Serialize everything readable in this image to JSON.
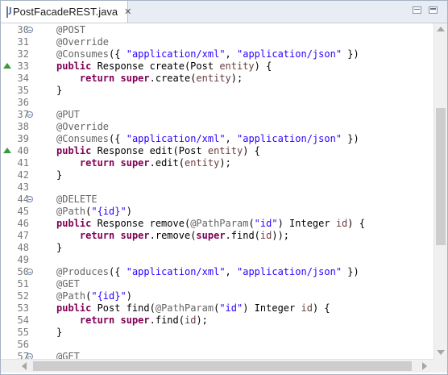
{
  "tab": {
    "title": "PostFacadeREST.java",
    "close_glyph": "✕",
    "icon": "java-file-icon",
    "icon_letter": "J"
  },
  "lines": [
    {
      "num": "30",
      "fold": true,
      "override": false,
      "tokens": [
        [
          "an",
          "@POST"
        ]
      ]
    },
    {
      "num": "31",
      "fold": false,
      "override": false,
      "tokens": [
        [
          "an",
          "@Override"
        ]
      ]
    },
    {
      "num": "32",
      "fold": false,
      "override": false,
      "tokens": [
        [
          "an",
          "@Consumes"
        ],
        [
          "",
          "({ "
        ],
        [
          "str",
          "\"application/xml\""
        ],
        [
          "",
          ", "
        ],
        [
          "str",
          "\"application/json\""
        ],
        [
          "",
          " })"
        ]
      ]
    },
    {
      "num": "33",
      "fold": false,
      "override": true,
      "tokens": [
        [
          "kw",
          "public"
        ],
        [
          "",
          " Response create(Post "
        ],
        [
          "prm",
          "entity"
        ],
        [
          "",
          ") {"
        ]
      ]
    },
    {
      "num": "34",
      "fold": false,
      "override": false,
      "tokens": [
        [
          "",
          "    "
        ],
        [
          "kw",
          "return"
        ],
        [
          "",
          " "
        ],
        [
          "kw",
          "super"
        ],
        [
          "",
          ".create("
        ],
        [
          "prm",
          "entity"
        ],
        [
          "",
          ");"
        ]
      ]
    },
    {
      "num": "35",
      "fold": false,
      "override": false,
      "tokens": [
        [
          "",
          "}"
        ]
      ]
    },
    {
      "num": "36",
      "fold": false,
      "override": false,
      "tokens": []
    },
    {
      "num": "37",
      "fold": true,
      "override": false,
      "tokens": [
        [
          "an",
          "@PUT"
        ]
      ]
    },
    {
      "num": "38",
      "fold": false,
      "override": false,
      "tokens": [
        [
          "an",
          "@Override"
        ]
      ]
    },
    {
      "num": "39",
      "fold": false,
      "override": false,
      "tokens": [
        [
          "an",
          "@Consumes"
        ],
        [
          "",
          "({ "
        ],
        [
          "str",
          "\"application/xml\""
        ],
        [
          "",
          ", "
        ],
        [
          "str",
          "\"application/json\""
        ],
        [
          "",
          " })"
        ]
      ]
    },
    {
      "num": "40",
      "fold": false,
      "override": true,
      "tokens": [
        [
          "kw",
          "public"
        ],
        [
          "",
          " Response edit(Post "
        ],
        [
          "prm",
          "entity"
        ],
        [
          "",
          ") {"
        ]
      ]
    },
    {
      "num": "41",
      "fold": false,
      "override": false,
      "tokens": [
        [
          "",
          "    "
        ],
        [
          "kw",
          "return"
        ],
        [
          "",
          " "
        ],
        [
          "kw",
          "super"
        ],
        [
          "",
          ".edit("
        ],
        [
          "prm",
          "entity"
        ],
        [
          "",
          ");"
        ]
      ]
    },
    {
      "num": "42",
      "fold": false,
      "override": false,
      "tokens": [
        [
          "",
          "}"
        ]
      ]
    },
    {
      "num": "43",
      "fold": false,
      "override": false,
      "tokens": []
    },
    {
      "num": "44",
      "fold": true,
      "override": false,
      "tokens": [
        [
          "an",
          "@DELETE"
        ]
      ]
    },
    {
      "num": "45",
      "fold": false,
      "override": false,
      "tokens": [
        [
          "an",
          "@Path"
        ],
        [
          "",
          "("
        ],
        [
          "str",
          "\"{id}\""
        ],
        [
          "",
          ")"
        ]
      ]
    },
    {
      "num": "46",
      "fold": false,
      "override": false,
      "tokens": [
        [
          "kw",
          "public"
        ],
        [
          "",
          " Response remove("
        ],
        [
          "an",
          "@PathParam"
        ],
        [
          "",
          "("
        ],
        [
          "str",
          "\"id\""
        ],
        [
          "",
          ") Integer "
        ],
        [
          "prm",
          "id"
        ],
        [
          "",
          ") {"
        ]
      ]
    },
    {
      "num": "47",
      "fold": false,
      "override": false,
      "tokens": [
        [
          "",
          "    "
        ],
        [
          "kw",
          "return"
        ],
        [
          "",
          " "
        ],
        [
          "kw",
          "super"
        ],
        [
          "",
          ".remove("
        ],
        [
          "kw",
          "super"
        ],
        [
          "",
          ".find("
        ],
        [
          "prm",
          "id"
        ],
        [
          "",
          "));"
        ]
      ]
    },
    {
      "num": "48",
      "fold": false,
      "override": false,
      "tokens": [
        [
          "",
          "}"
        ]
      ]
    },
    {
      "num": "49",
      "fold": false,
      "override": false,
      "tokens": []
    },
    {
      "num": "50",
      "fold": true,
      "override": false,
      "tokens": [
        [
          "an",
          "@Produces"
        ],
        [
          "",
          "({ "
        ],
        [
          "str",
          "\"application/xml\""
        ],
        [
          "",
          ", "
        ],
        [
          "str",
          "\"application/json\""
        ],
        [
          "",
          " })"
        ]
      ]
    },
    {
      "num": "51",
      "fold": false,
      "override": false,
      "tokens": [
        [
          "an",
          "@GET"
        ]
      ]
    },
    {
      "num": "52",
      "fold": false,
      "override": false,
      "tokens": [
        [
          "an",
          "@Path"
        ],
        [
          "",
          "("
        ],
        [
          "str",
          "\"{id}\""
        ],
        [
          "",
          ")"
        ]
      ]
    },
    {
      "num": "53",
      "fold": false,
      "override": false,
      "tokens": [
        [
          "kw",
          "public"
        ],
        [
          "",
          " Post find("
        ],
        [
          "an",
          "@PathParam"
        ],
        [
          "",
          "("
        ],
        [
          "str",
          "\"id\""
        ],
        [
          "",
          ") Integer "
        ],
        [
          "prm",
          "id"
        ],
        [
          "",
          ") {"
        ]
      ]
    },
    {
      "num": "54",
      "fold": false,
      "override": false,
      "tokens": [
        [
          "",
          "    "
        ],
        [
          "kw",
          "return"
        ],
        [
          "",
          " "
        ],
        [
          "kw",
          "super"
        ],
        [
          "",
          ".find("
        ],
        [
          "prm",
          "id"
        ],
        [
          "",
          ");"
        ]
      ]
    },
    {
      "num": "55",
      "fold": false,
      "override": false,
      "tokens": [
        [
          "",
          "}"
        ]
      ]
    },
    {
      "num": "56",
      "fold": false,
      "override": false,
      "tokens": []
    },
    {
      "num": "57",
      "fold": true,
      "override": false,
      "tokens": [
        [
          "an",
          "@GET"
        ]
      ]
    }
  ],
  "colors": {
    "annotation": "#646464",
    "keyword": "#7f0055",
    "string": "#2a00ff",
    "parameter": "#6a3e3e",
    "line_number": "#787878",
    "override_marker": "#3a9a3a"
  }
}
